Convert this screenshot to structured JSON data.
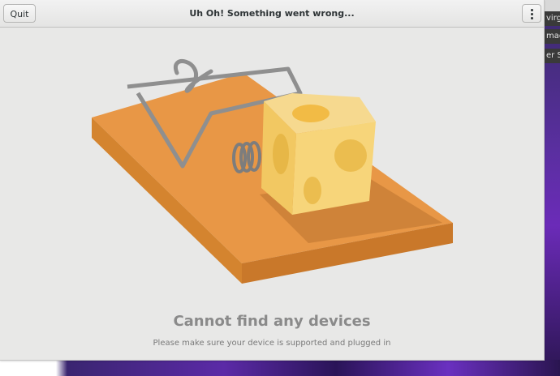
{
  "window": {
    "title": "Uh Oh! Something went wrong...",
    "quit_label": "Quit"
  },
  "message": {
    "heading": "Cannot find any devices",
    "subtext": "Please make sure your device is supported and plugged in"
  },
  "background": {
    "tabs": [
      "virgi",
      "madi",
      "er Sn"
    ]
  },
  "icons": [
    "menu-dots-icon",
    "mousetrap-illustration"
  ],
  "colors": {
    "wood_top": "#e79544",
    "wood_side": "#c97a2a",
    "cheese": "#f7d67e",
    "cheese_hole": "#ebbd4f",
    "wire": "#8f8f8f"
  }
}
